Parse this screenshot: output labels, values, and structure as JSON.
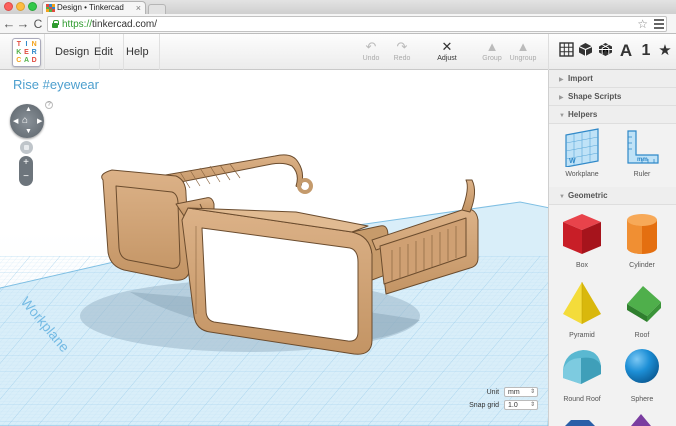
{
  "browser": {
    "tab_title": "Design • Tinkercad",
    "tab_close": "×",
    "url_scheme": "https://",
    "url_host": "tinkercad.com/",
    "back_glyph": "←",
    "forward_glyph": "→",
    "reload_glyph": "C",
    "bookmark_glyph": "☆"
  },
  "logo": {
    "letters": [
      "T",
      "I",
      "N",
      "K",
      "E",
      "R",
      "C",
      "A",
      "D"
    ],
    "colors": [
      "#e04b3f",
      "#2f88c8",
      "#f3a21c",
      "#53b14a",
      "#e04b3f",
      "#2f88c8",
      "#f3a21c",
      "#53b14a",
      "#e04b3f"
    ]
  },
  "menu": {
    "design": "Design",
    "edit": "Edit",
    "help": "Help"
  },
  "tools": {
    "undo": {
      "label": "Undo",
      "icon": "↶"
    },
    "redo": {
      "label": "Redo",
      "icon": "↷"
    },
    "adjust": {
      "label": "Adjust",
      "icon": "✕"
    },
    "group": {
      "label": "Group",
      "icon": "▲"
    },
    "ungroup": {
      "label": "Ungroup",
      "icon": "▲"
    }
  },
  "view_icons": {
    "letter_icon": "A",
    "number_icon": "1",
    "star_icon": "★"
  },
  "workspace": {
    "design_title": "Rise #eyewear",
    "help_glyph": "?",
    "workplane_label": "Workplane",
    "zoom_plus": "+",
    "zoom_minus": "−",
    "unit_label": "Unit",
    "unit_value": "mm",
    "snap_label": "Snap grid",
    "snap_value": "1.0"
  },
  "panel": {
    "import": "Import",
    "shape_scripts": "Shape Scripts",
    "helpers": "Helpers",
    "geometric": "Geometric",
    "collapsed_glyph": "▶",
    "expanded_glyph": "▼",
    "helper_items": [
      "Workplane",
      "Ruler"
    ],
    "geometric_items": [
      "Box",
      "Cylinder",
      "Pyramid",
      "Roof",
      "Round Roof",
      "Sphere"
    ]
  },
  "colors": {
    "accent": "#4d9fce",
    "glasses": "#d4a77a",
    "grid": "#9fd1ee",
    "box": "#d21f2a",
    "cylinder": "#ef7d18",
    "pyramid": "#f1d21d",
    "roof": "#3d9b3b",
    "round_roof": "#5ab8d1",
    "sphere": "#1d8fd6"
  }
}
